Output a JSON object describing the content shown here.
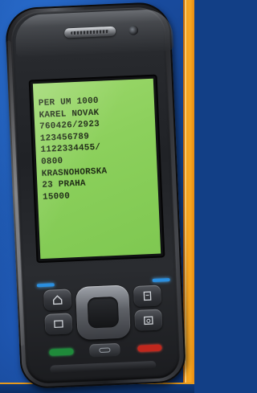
{
  "phone_screen": {
    "lines": [
      "PER UM 1000",
      "KAREL NOVAK",
      "760426/2923",
      "123456789",
      "1122334455/",
      "0800",
      "KRASNOHORSKA",
      "23 PRAHA",
      "15000"
    ],
    "screen_color": "#8cd05c"
  },
  "keypad": {
    "icons": [
      "home-icon",
      "menu-icon",
      "contacts-icon",
      "calendar-icon",
      "message-icon",
      "call-icon",
      "end-call-icon"
    ],
    "call_color": "#1f8a3a",
    "end_color": "#c0271d"
  },
  "background": {
    "main_color": "#123f86",
    "accent_color": "#f39a17"
  }
}
